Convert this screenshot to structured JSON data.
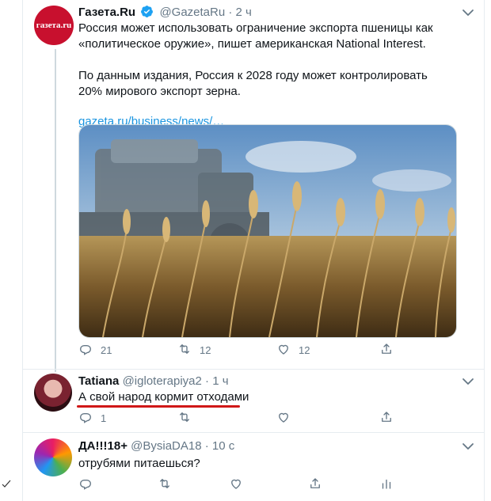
{
  "tweets": [
    {
      "name": "Газета.Ru",
      "handle": "@GazetaRu",
      "dot": "·",
      "time": "2 ч",
      "avatar_text": "газета.ru",
      "paragraph1": "Россия может использовать ограничение экспорта пшеницы как «политическое оружие», пишет американская National Interest.",
      "paragraph2": "По данным издания, Россия к 2028 году может контролировать 20% мирового экспорт зерна.",
      "link": "gazeta.ru/business/news/…",
      "reply_count": "21",
      "retweet_count": "12",
      "like_count": "12"
    },
    {
      "name": "Tatiana",
      "handle": "@igloterapiya2",
      "dot": "·",
      "time": "1 ч",
      "text": "А свой народ кормит отходами",
      "reply_count": "1",
      "retweet_count": "",
      "like_count": ""
    },
    {
      "name": "ДА!!!18+",
      "handle": "@BysiaDA18",
      "dot": "·",
      "time": "10 с",
      "text": "отрубями питаешься?",
      "reply_count": "",
      "retweet_count": "",
      "like_count": ""
    }
  ],
  "colors": {
    "accent": "#1b95e0",
    "muted": "#657786",
    "brand_red": "#c8102e",
    "underline": "#d01717"
  },
  "icons": [
    "reply-icon",
    "retweet-icon",
    "like-icon",
    "share-icon",
    "analytics-icon",
    "verified-icon",
    "chevron-down-icon"
  ]
}
